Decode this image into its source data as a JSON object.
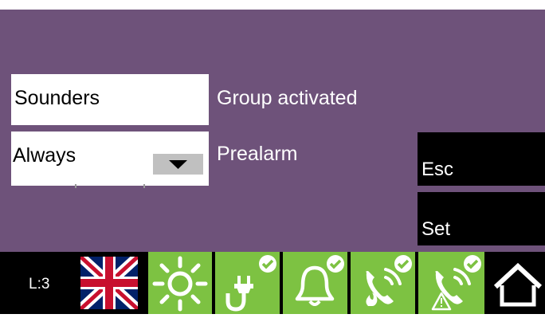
{
  "fields": {
    "sounders": "Sounders",
    "always": "Always"
  },
  "labels": {
    "group_activated": "Group activated",
    "prealarm": "Prealarm"
  },
  "buttons": {
    "esc": "Esc",
    "set": "Set"
  },
  "status_bar": {
    "level": "L:3",
    "icons": [
      "uk-flag-icon",
      "brightness-icon",
      "power-plug-ok-icon",
      "bell-ok-icon",
      "phone-fire-ok-icon",
      "phone-warning-ok-icon",
      "home-icon"
    ]
  },
  "colors": {
    "panel_bg": "#6e527a",
    "status_green": "#7dc242"
  }
}
